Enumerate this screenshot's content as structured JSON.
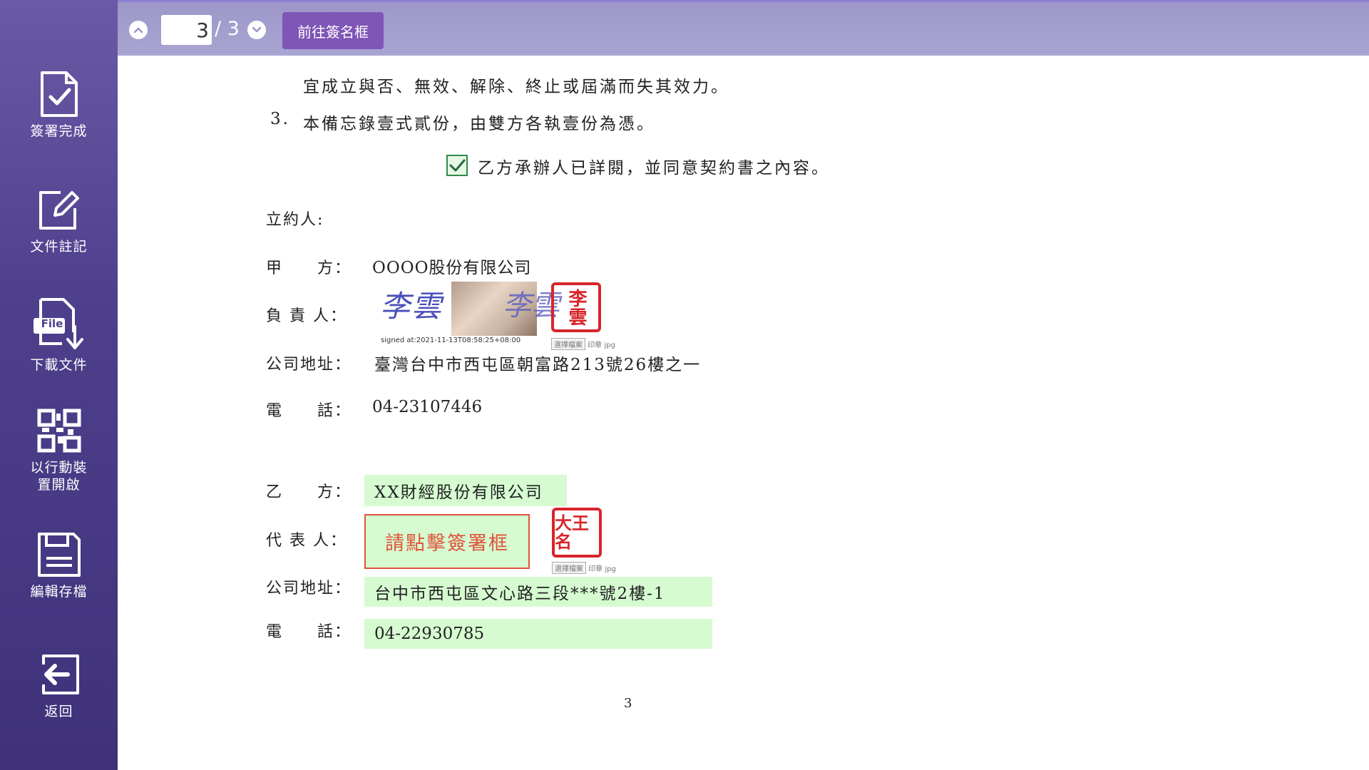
{
  "sidebar": {
    "items": [
      {
        "label": "簽署完成",
        "icon": "document-check-icon"
      },
      {
        "label": "文件註記",
        "icon": "edit-note-icon"
      },
      {
        "label": "下載文件",
        "icon": "file-download-icon",
        "badge": "File"
      },
      {
        "label_line1": "以行動裝",
        "label_line2": "置開啟",
        "icon": "qr-code-icon"
      },
      {
        "label": "編輯存檔",
        "icon": "save-icon"
      },
      {
        "label": "返回",
        "icon": "back-arrow-icon"
      }
    ]
  },
  "toolbar": {
    "current_page": "3",
    "total_pages": "/ 3",
    "goto_label": "前往簽名框"
  },
  "document": {
    "line1": "宜成立與否、無效、解除、終止或屆滿而失其效力。",
    "clause3_num": "3.",
    "clause3": "本備忘錄壹式貳份，由雙方各執壹份為憑。",
    "agree_text": "乙方承辦人已詳閱，並同意契約書之內容。",
    "agree_checked": true,
    "parties_heading": "立約人:",
    "party_a": {
      "label": "甲　　方：",
      "name": "OOOO股份有限公司",
      "rep_label": "負 責 人：",
      "signature_text": "李雲",
      "signed_at": "signed at:2021-11-13T08:58:25+08:00",
      "seal_text": "李雲",
      "seal_btn": "選擇檔案",
      "seal_hint": "印章 jpg",
      "addr_label": "公司地址：",
      "address": "臺灣台中市西屯區朝富路213號26樓之一",
      "phone_label": "電　　話：",
      "phone": "04-23107446"
    },
    "party_b": {
      "label": "乙　　方：",
      "name": "XX財經股份有限公司",
      "rep_label": "代 表 人：",
      "sign_prompt": "請點擊簽署框",
      "seal_text": "大王名",
      "seal_btn": "選擇檔案",
      "seal_hint": "印章 jpg",
      "addr_label": "公司地址：",
      "address": "台中市西屯區文心路三段***號2樓-1",
      "phone_label": "電　　話：",
      "phone": "04-22930785"
    },
    "page_number": "3"
  },
  "colors": {
    "sidebar": "#4e3f8c",
    "toolbar": "#a9a5d2",
    "accent_button": "#7f55b7",
    "field_green": "#d6fbd1",
    "seal_red": "#d8252a",
    "sign_prompt": "#e0543a"
  }
}
